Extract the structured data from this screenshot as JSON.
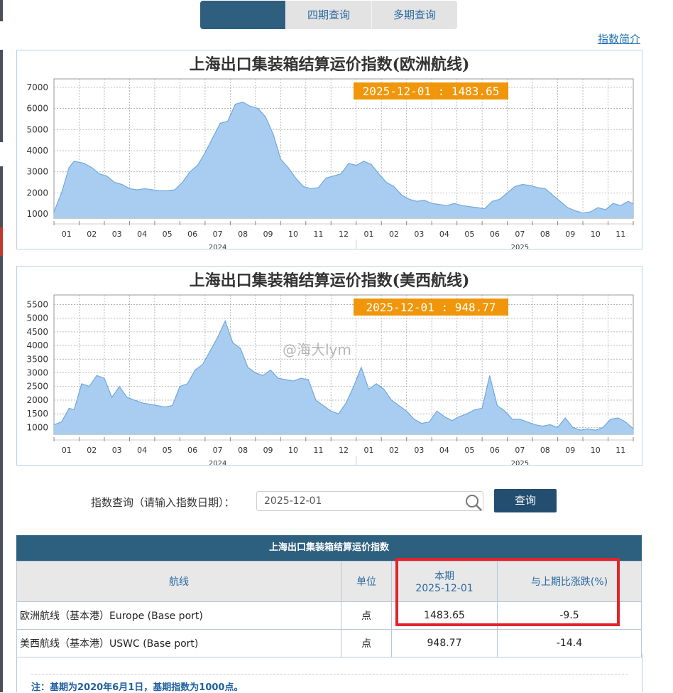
{
  "tabs": [
    {
      "label": "",
      "active": true
    },
    {
      "label": "四期查询",
      "active": false
    },
    {
      "label": "多期查询",
      "active": false
    }
  ],
  "intro_link": "指数简介",
  "charts": [
    {
      "title": "上海出口集装箱结算运价指数(欧洲航线)",
      "tooltip": "2025-12-01 : 1483.65",
      "y_ticks": [
        1000,
        2000,
        3000,
        4000,
        5000,
        6000,
        7000
      ],
      "ylim": [
        800,
        7400
      ],
      "month_labels": [
        "01",
        "02",
        "03",
        "04",
        "05",
        "06",
        "07",
        "08",
        "09",
        "10",
        "11",
        "12",
        "01",
        "02",
        "03",
        "04",
        "05",
        "06",
        "07",
        "08",
        "09",
        "10",
        "11"
      ],
      "year_labels": [
        "2024",
        "2025"
      ],
      "x": [
        0,
        0.3,
        0.6,
        0.8,
        1.2,
        1.5,
        1.8,
        2.1,
        2.4,
        2.7,
        3.0,
        3.3,
        3.6,
        3.9,
        4.2,
        4.5,
        4.8,
        5.1,
        5.4,
        5.7,
        6.0,
        6.3,
        6.6,
        6.9,
        7.2,
        7.5,
        7.8,
        8.1,
        8.4,
        8.7,
        9.0,
        9.3,
        9.6,
        9.9,
        10.2,
        10.5,
        10.8,
        11.1,
        11.4,
        11.7,
        12.0,
        12.3,
        12.6,
        12.9,
        13.2,
        13.5,
        13.8,
        14.1,
        14.4,
        14.7,
        15.0,
        15.3,
        15.6,
        15.9,
        16.2,
        16.5,
        16.8,
        17.1,
        17.4,
        17.7,
        18.0,
        18.3,
        18.6,
        18.9,
        19.2,
        19.5,
        19.8,
        20.1,
        20.4,
        20.7,
        21.0,
        21.3,
        21.6,
        21.9,
        22.2,
        22.5,
        22.8,
        23.0
      ],
      "y": [
        1100,
        2000,
        3200,
        3500,
        3400,
        3200,
        2900,
        2800,
        2500,
        2400,
        2200,
        2150,
        2200,
        2150,
        2100,
        2100,
        2150,
        2500,
        3000,
        3300,
        3900,
        4600,
        5300,
        5400,
        6200,
        6300,
        6100,
        6000,
        5600,
        4800,
        3600,
        3200,
        2700,
        2300,
        2200,
        2250,
        2700,
        2800,
        2900,
        3400,
        3300,
        3500,
        3350,
        2900,
        2500,
        2300,
        1900,
        1700,
        1600,
        1650,
        1500,
        1450,
        1400,
        1500,
        1400,
        1350,
        1300,
        1250,
        1600,
        1700,
        2000,
        2300,
        2400,
        2350,
        2250,
        2200,
        1900,
        1600,
        1300,
        1150,
        1050,
        1100,
        1300,
        1200,
        1500,
        1400,
        1600,
        1480
      ],
      "color": "#a9cdf1"
    },
    {
      "title": "上海出口集装箱结算运价指数(美西航线)",
      "tooltip": "2025-12-01 : 948.77",
      "y_ticks": [
        1000,
        1500,
        2000,
        2500,
        3000,
        3500,
        4000,
        4500,
        5000,
        5500
      ],
      "ylim": [
        750,
        5850
      ],
      "month_labels": [
        "01",
        "02",
        "03",
        "04",
        "05",
        "06",
        "07",
        "08",
        "09",
        "10",
        "11",
        "12",
        "01",
        "02",
        "03",
        "04",
        "05",
        "06",
        "07",
        "08",
        "09",
        "10",
        "11"
      ],
      "year_labels": [
        "2024",
        "2025"
      ],
      "x": [
        0,
        0.3,
        0.6,
        0.8,
        1.1,
        1.4,
        1.7,
        2.0,
        2.3,
        2.6,
        2.9,
        3.2,
        3.5,
        3.8,
        4.1,
        4.4,
        4.7,
        5.0,
        5.3,
        5.6,
        5.9,
        6.2,
        6.5,
        6.8,
        7.1,
        7.4,
        7.7,
        8.0,
        8.3,
        8.6,
        8.9,
        9.2,
        9.5,
        9.8,
        10.1,
        10.4,
        10.7,
        11.0,
        11.3,
        11.6,
        11.9,
        12.2,
        12.5,
        12.8,
        13.1,
        13.4,
        13.7,
        14.0,
        14.3,
        14.6,
        14.9,
        15.2,
        15.5,
        15.8,
        16.1,
        16.4,
        16.7,
        17.0,
        17.3,
        17.6,
        17.9,
        18.2,
        18.5,
        18.8,
        19.1,
        19.4,
        19.7,
        20.0,
        20.3,
        20.6,
        20.9,
        21.2,
        21.5,
        21.8,
        22.1,
        22.4,
        22.7,
        23.0
      ],
      "y": [
        1100,
        1200,
        1700,
        1650,
        2600,
        2500,
        2900,
        2800,
        2100,
        2500,
        2100,
        2000,
        1900,
        1850,
        1800,
        1750,
        1800,
        2500,
        2600,
        3100,
        3300,
        3800,
        4300,
        4900,
        4100,
        3900,
        3200,
        3000,
        2900,
        3100,
        2800,
        2750,
        2700,
        2800,
        2750,
        2000,
        1800,
        1600,
        1500,
        1900,
        2500,
        3200,
        2400,
        2600,
        2400,
        2000,
        1800,
        1600,
        1300,
        1150,
        1200,
        1600,
        1400,
        1250,
        1400,
        1500,
        1650,
        1700,
        2900,
        1800,
        1600,
        1300,
        1300,
        1200,
        1100,
        1050,
        1100,
        1000,
        1350,
        1000,
        900,
        950,
        900,
        1000,
        1300,
        1350,
        1200,
        950
      ],
      "color": "#a9cdf1"
    }
  ],
  "watermark": "@海大lym",
  "query": {
    "label": "指数查询（请输入指数日期）：",
    "value": "2025-12-01",
    "button": "查询"
  },
  "table": {
    "title": "上海出口集装箱结算运价指数",
    "headers": [
      "航线",
      "单位",
      "本期",
      "2025-12-01",
      "与上期比涨跌(%)"
    ],
    "rows": [
      {
        "route": "欧洲航线（基本港）Europe (Base port)",
        "unit": "点",
        "current": "1483.65",
        "change": "-9.5"
      },
      {
        "route": "美西航线（基本港）USWC (Base port)",
        "unit": "点",
        "current": "948.77",
        "change": "-14.4"
      }
    ]
  },
  "note": "注：基期为2020年6月1日，基期指数为1000点。"
}
